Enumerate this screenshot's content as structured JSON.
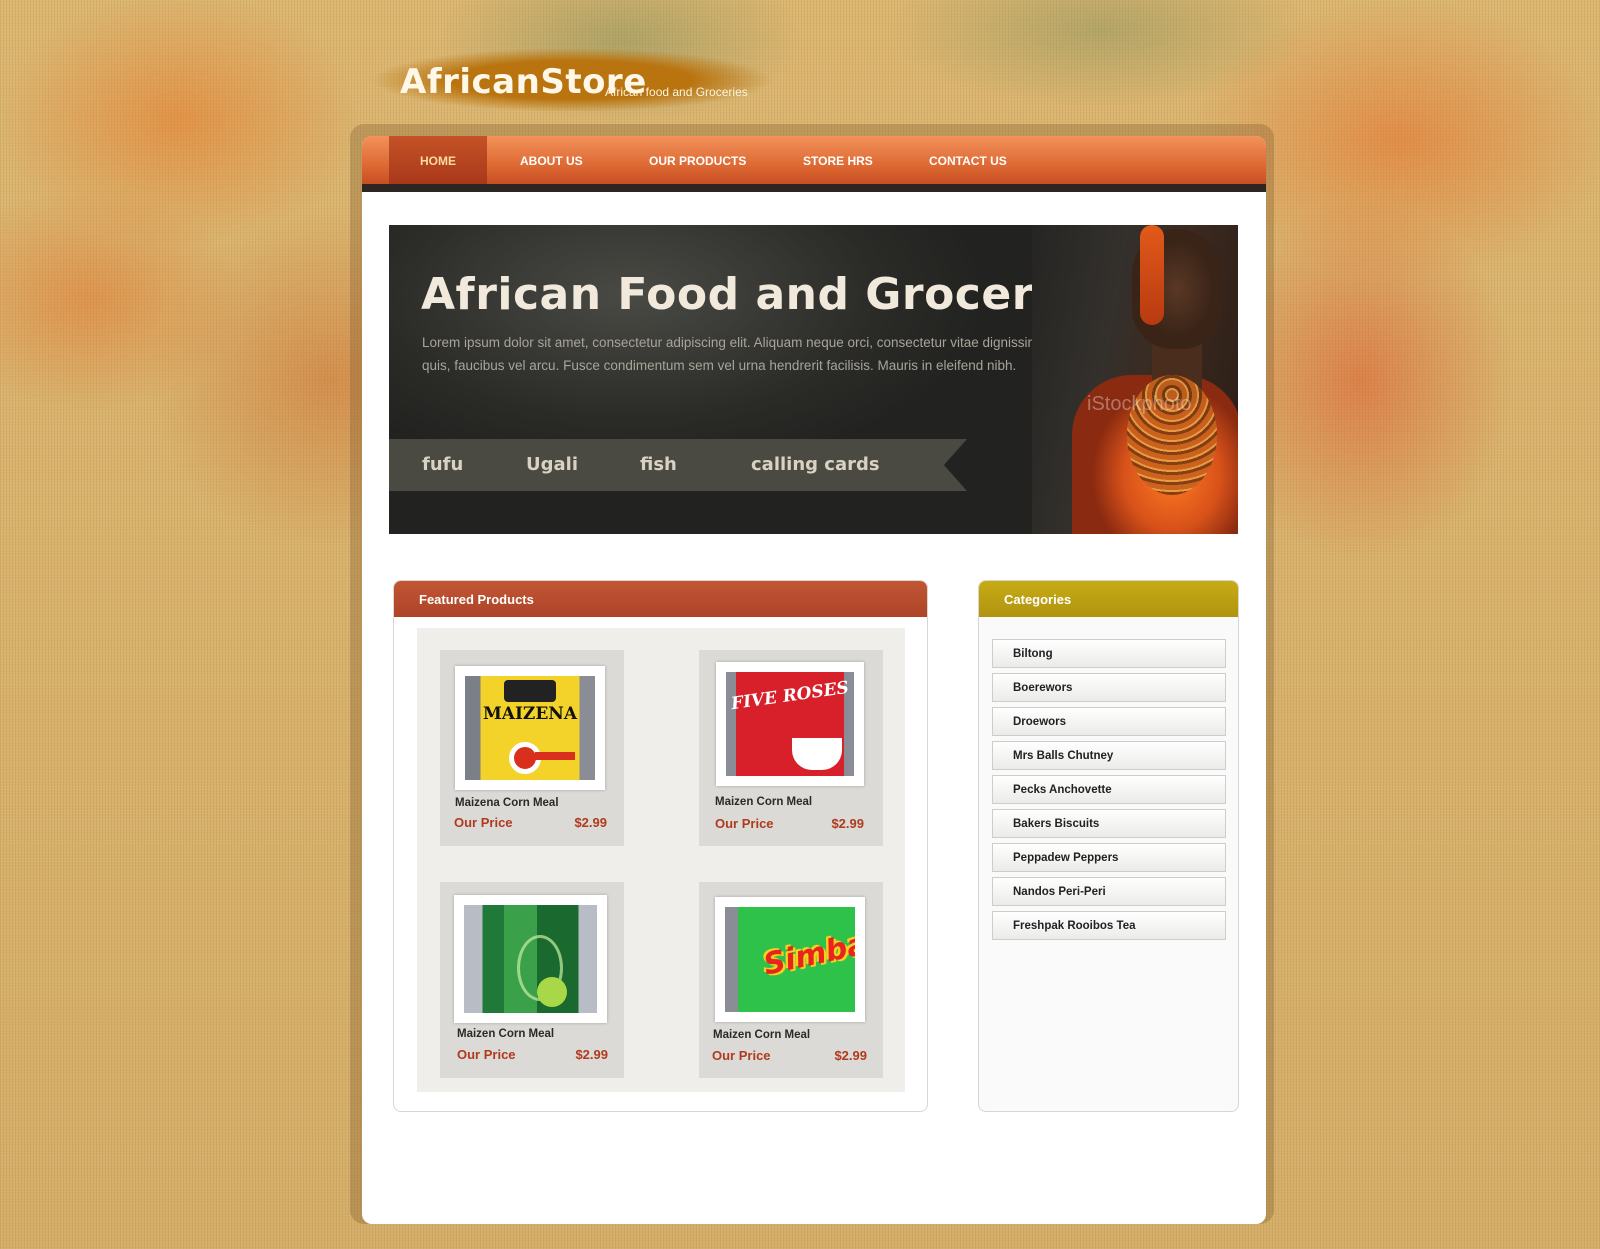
{
  "header": {
    "logo": "AfricanStore",
    "tagline": "African food and Groceries"
  },
  "nav": {
    "items": [
      {
        "label": "HOME",
        "active": true
      },
      {
        "label": "ABOUT US"
      },
      {
        "label": "OUR PRODUCTS"
      },
      {
        "label": "STORE HRS"
      },
      {
        "label": "CONTACT US"
      }
    ]
  },
  "banner": {
    "title": "African Food and Groceries",
    "text_line1": "Lorem ipsum dolor sit amet, consectetur adipiscing elit. Aliquam neque orci, consectetur  vitae dignissim",
    "text_line2": "quis, faucibus vel arcu. Fusce condimentum sem vel urna hendrerit facilisis. Mauris in eleifend nibh.",
    "tags": [
      "fufu",
      "Ugali",
      "fish",
      "calling cards"
    ],
    "watermark": "iStockphoto"
  },
  "featured": {
    "title": "Featured  Products",
    "products": [
      {
        "name": "Maizena Corn Meal",
        "price_label": "Our Price",
        "price": "$2.99",
        "art_text": "MAIZENA"
      },
      {
        "name": "Maizen Corn Meal",
        "price_label": "Our Price",
        "price": "$2.99",
        "art_text": "FIVE ROSES"
      },
      {
        "name": "Maizen Corn Meal",
        "price_label": "Our Price",
        "price": "$2.99",
        "art_text": ""
      },
      {
        "name": "Maizen Corn Meal",
        "price_label": "Our Price",
        "price": "$2.99",
        "art_text": "Simba"
      }
    ]
  },
  "categories": {
    "title": "Categories",
    "items": [
      "Biltong",
      "Boerewors",
      "Droewors",
      "Mrs Balls Chutney",
      "Pecks Anchovette",
      "Bakers Biscuits",
      "Peppadew Peppers",
      "Nandos Peri-Peri",
      "Freshpak Rooibos Tea"
    ]
  },
  "colors": {
    "nav": "#de6a34",
    "featured_header": "#b44a2c",
    "categories_header": "#bfa212",
    "price": "#b03a1e"
  }
}
